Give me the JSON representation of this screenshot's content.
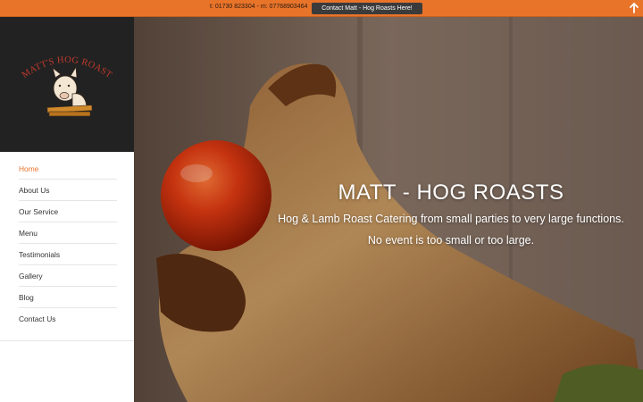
{
  "topbar": {
    "phone_text": "t: 01730 823304 - m: 07768903464",
    "contact_button": "Contact Matt - Hog Roasts Here!",
    "up_icon": "arrow-up-icon",
    "bg_color": "#e8742a"
  },
  "logo": {
    "text": "MATT'S HOG ROAST",
    "text_color": "#c0392b"
  },
  "nav": {
    "items": [
      {
        "label": "Home"
      },
      {
        "label": "About Us"
      },
      {
        "label": "Our Service"
      },
      {
        "label": "Menu"
      },
      {
        "label": "Testimonials"
      },
      {
        "label": "Gallery"
      },
      {
        "label": "Blog"
      },
      {
        "label": "Contact Us"
      }
    ],
    "active_color": "#e8742a"
  },
  "hero": {
    "title": "MATT - HOG ROASTS",
    "subtitle_line1": "Hog & Lamb Roast Catering from small parties to very large functions.",
    "subtitle_line2": "No event is too small or too large."
  }
}
